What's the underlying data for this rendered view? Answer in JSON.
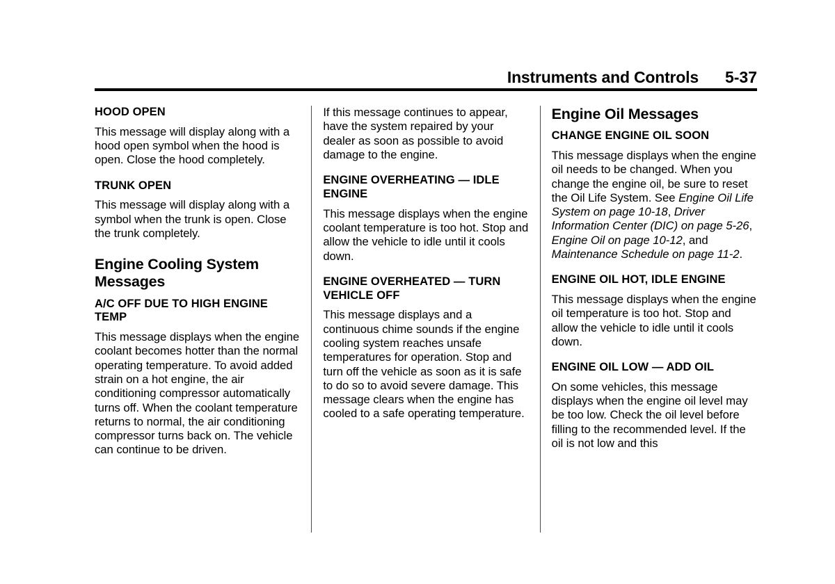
{
  "header": {
    "title": "Instruments and Controls",
    "folio": "5-37"
  },
  "columns": {
    "col1": {
      "hood_open_head": "HOOD OPEN",
      "hood_open_body": "This message will display along with a hood open symbol when the hood is open. Close the hood completely.",
      "trunk_open_head": "TRUNK OPEN",
      "trunk_open_body": "This message will display along with a symbol when the trunk is open. Close the trunk completely.",
      "cooling_section_head": "Engine Cooling System Messages",
      "ac_off_head": "A/C OFF DUE TO HIGH ENGINE TEMP",
      "ac_off_body": "This message displays when the engine coolant becomes hotter than the normal operating temperature. To avoid added strain on a hot engine, the air conditioning compressor automatically turns off. When the coolant temperature returns to normal, the air conditioning compressor turns back on. The vehicle can continue to be driven."
    },
    "col2": {
      "continued_body": "If this message continues to appear, have the system repaired by your dealer as soon as possible to avoid damage to the engine.",
      "overheating_head": "ENGINE OVERHEATING — IDLE ENGINE",
      "overheating_body": "This message displays when the engine coolant temperature is too hot. Stop and allow the vehicle to idle until it cools down.",
      "overheated_head": "ENGINE OVERHEATED — TURN VEHICLE OFF",
      "overheated_body": "This message displays and a continuous chime sounds if the engine cooling system reaches unsafe temperatures for operation. Stop and turn off the vehicle as soon as it is safe to do so to avoid severe damage. This message clears when the engine has cooled to a safe operating temperature."
    },
    "col3": {
      "oil_section_head": "Engine Oil Messages",
      "change_oil_head": "CHANGE ENGINE OIL SOON",
      "change_oil_body_1": "This message displays when the engine oil needs to be changed. When you change the engine oil, be sure to reset the Oil Life System. See ",
      "xref_1": "Engine Oil Life System on page 10-18",
      "change_oil_body_2": ", ",
      "xref_2": "Driver Information Center (DIC) on page 5-26",
      "change_oil_body_3": ", ",
      "xref_3": "Engine Oil on page 10-12",
      "change_oil_body_4": ", and ",
      "xref_4": "Maintenance Schedule on page 11-2",
      "change_oil_body_5": ".",
      "oil_hot_head": "ENGINE OIL HOT, IDLE ENGINE",
      "oil_hot_body": "This message displays when the engine oil temperature is too hot. Stop and allow the vehicle to idle until it cools down.",
      "oil_low_head": "ENGINE OIL LOW — ADD OIL",
      "oil_low_body": "On some vehicles, this message displays when the engine oil level may be too low. Check the oil level before filling to the recommended level. If the oil is not low and this"
    }
  }
}
